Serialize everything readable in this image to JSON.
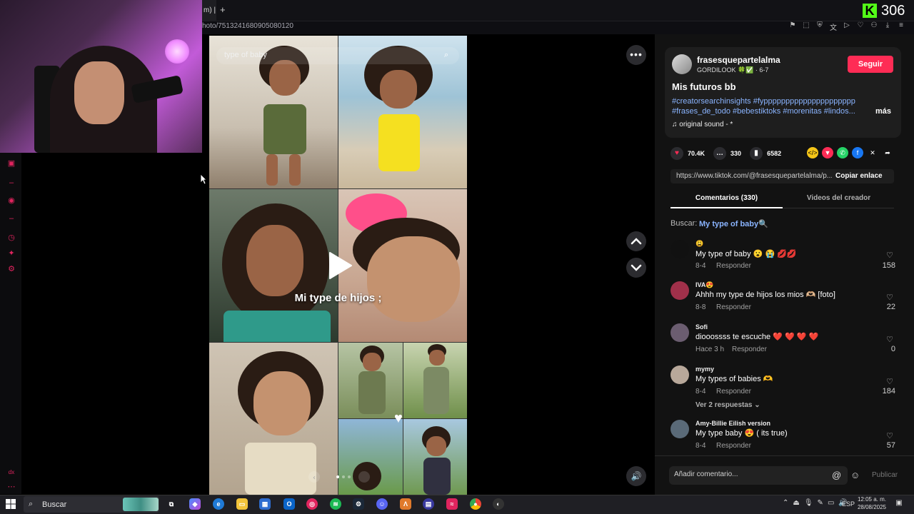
{
  "colors": {
    "accent": "#fe2c55",
    "link": "#8ab4ff",
    "kick_green": "#53fc18",
    "panel_bg": "#121212",
    "card_bg": "#1e1e1e"
  },
  "browser": {
    "tab_label": "m) |",
    "new_tab": "+",
    "url": "hoto/7513241680905080120",
    "toolbar_icons": [
      "bookmark-icon",
      "crop-icon",
      "shield-icon",
      "translate-icon",
      "send-icon",
      "heart-icon",
      "account-icon",
      "download-icon",
      "menu-icon"
    ]
  },
  "kick_overlay": {
    "logo": "K",
    "viewer_count": "306"
  },
  "photo": {
    "search_text": "type of baby",
    "caption": "Mi type de hijos ;",
    "more_label": "•••"
  },
  "post": {
    "author": "frasesquepartelalma",
    "author_sub": "GORDILOOK 🍀✅ · 6-7",
    "follow_label": "Seguir",
    "title": "Mis futuros bb",
    "tags_line1": "#creatorsearchinsights #fyppppppppppppppppppppp",
    "tags_line2": "#frases_de_todo #bebestiktoks #morenitas #lindos...",
    "more_label": "más",
    "music": "♫  original sound - *"
  },
  "stats": {
    "likes": "70.4K",
    "comments": "330",
    "saves": "6582"
  },
  "share": {
    "link": "https://www.tiktok.com/@frasesquepartelalma/p...",
    "copy_label": "Copiar enlace"
  },
  "tabs": {
    "comments": "Comentarios (330)",
    "creator_videos": "Videos del creador"
  },
  "search": {
    "label": "Buscar:",
    "term": "My type of baby🔍"
  },
  "comments": [
    {
      "name": "😩",
      "text": "My type of baby 😮 😭 💋💋",
      "date": "8-4",
      "reply": "Responder",
      "likes": "158",
      "avatar_color": "#111111"
    },
    {
      "name": "IVA😍",
      "text": "Ahhh my type de hijos los mios 🫶🏼 [foto]",
      "date": "8-8",
      "reply": "Responder",
      "likes": "22",
      "avatar_color": "#a0304a"
    },
    {
      "name": "Sofi",
      "text": "diooossss te escuche ❤️ ❤️ ❤️ ❤️",
      "date": "Hace 3 h",
      "reply": "Responder",
      "likes": "0",
      "avatar_color": "#6b5d70"
    },
    {
      "name": "mymy",
      "text": "My types of babies 🫶",
      "date": "8-4",
      "reply": "Responder",
      "likes": "184",
      "avatar_color": "#b8a89a"
    },
    {
      "name": "Amy-Billie Eilish version",
      "text": "My type baby 😍 ( its true)",
      "date": "8-4",
      "reply": "Responder",
      "likes": "57",
      "avatar_color": "#5a6a78"
    }
  ],
  "view_replies": "Ver 2 respuestas ⌄",
  "composer": {
    "placeholder": "Añadir comentario...",
    "publish": "Publicar"
  },
  "taskbar": {
    "search_placeholder": "Buscar",
    "language": "ESP",
    "time": "12:05 a. m.",
    "date": "28/08/2025",
    "notification_count": "2"
  }
}
